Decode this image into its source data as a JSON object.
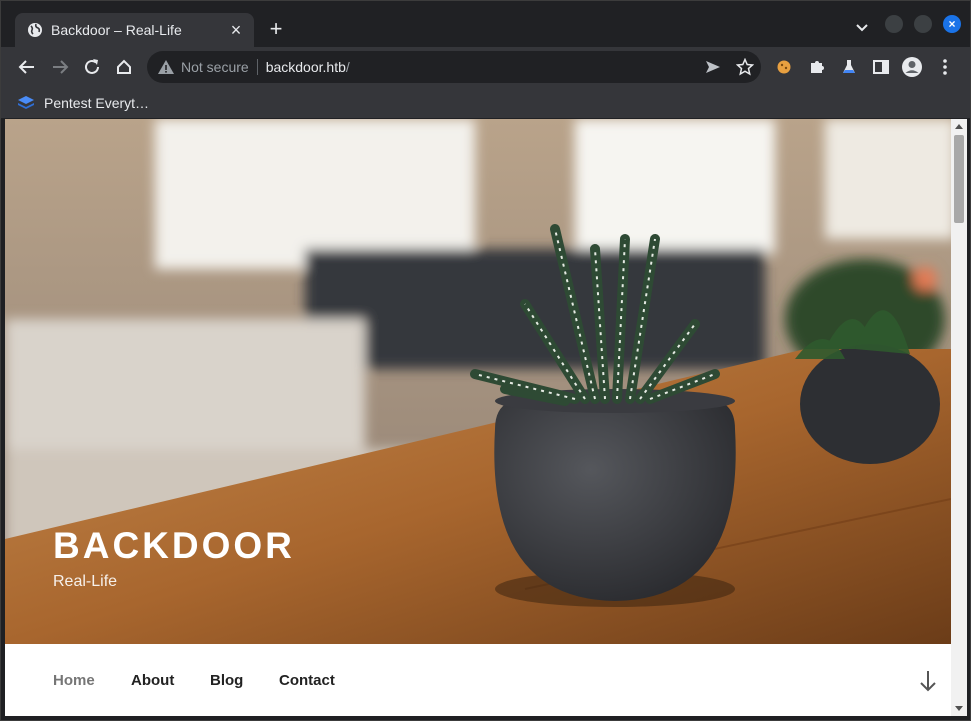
{
  "browser": {
    "tab": {
      "title": "Backdoor – Real-Life",
      "favicon": "globe-icon",
      "close_label": "×"
    },
    "new_tab_label": "+",
    "close_window_label": "×",
    "address": {
      "security_label": "Not secure",
      "url_host": "backdoor.htb",
      "url_path": "/"
    },
    "bookmarks": [
      {
        "label": "Pentest Everyt…",
        "icon": "stack-icon"
      }
    ],
    "colors": {
      "frame": "#202124",
      "toolbar": "#35363a",
      "accent": "#1a73e8"
    }
  },
  "site": {
    "title": "BACKDOOR",
    "description": "Real-Life",
    "nav": [
      {
        "label": "Home",
        "active": true
      },
      {
        "label": "About",
        "active": false
      },
      {
        "label": "Blog",
        "active": false
      },
      {
        "label": "Contact",
        "active": false
      }
    ]
  }
}
